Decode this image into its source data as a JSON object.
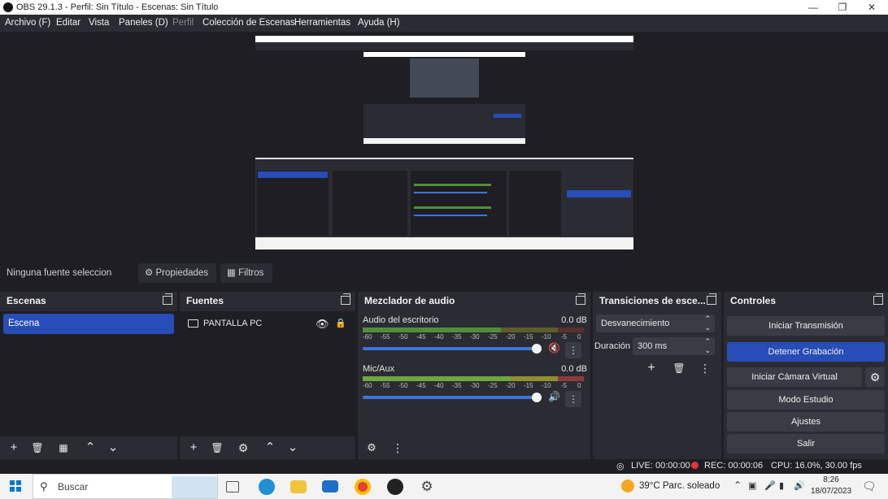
{
  "window": {
    "title": "OBS 29.1.3 - Perfil: Sin Título - Escenas: Sin Título",
    "minimize_icon": "minimize-icon",
    "maximize_icon": "restore-icon",
    "close_icon": "close-icon"
  },
  "menu": {
    "items": [
      "Archivo (F)",
      "Editar",
      "Vista",
      "Paneles (D)",
      "Perfil",
      "Colección de Escenas",
      "Herramientas",
      "Ayuda (H)"
    ]
  },
  "source_toolbar": {
    "no_source": "Ninguna fuente seleccionada",
    "properties": "Propiedades",
    "filters": "Filtros"
  },
  "scenes": {
    "title": "Escenas",
    "items": [
      "Escena"
    ]
  },
  "sources": {
    "title": "Fuentes",
    "items": [
      {
        "name": "PANTALLA PC",
        "icon": "monitor-icon",
        "visible": true,
        "locked": true
      }
    ]
  },
  "mixer": {
    "title": "Mezclador de audio",
    "channels": [
      {
        "name": "Audio del escritorio",
        "db": "0.0 dB",
        "volume": 1.0,
        "muted": true
      },
      {
        "name": "Mic/Aux",
        "db": "0.0 dB",
        "volume": 1.0,
        "muted": false
      }
    ],
    "ticks": [
      "-60",
      "-55",
      "-50",
      "-45",
      "-40",
      "-35",
      "-30",
      "-25",
      "-20",
      "-15",
      "-10",
      "-5",
      "0"
    ]
  },
  "transitions": {
    "title": "Transiciones de esce...",
    "selected": "Desvanecimiento",
    "duration_label": "Duración",
    "duration_value": "300 ms"
  },
  "controls": {
    "title": "Controles",
    "start_stream": "Iniciar Transmisión",
    "stop_recording": "Detener Grabación",
    "start_virtual_cam": "Iniciar Cámara Virtual",
    "studio_mode": "Modo Estudio",
    "settings": "Ajustes",
    "exit": "Salir"
  },
  "status": {
    "live": "LIVE: 00:00:00",
    "rec": "REC: 00:00:06",
    "cpu": "CPU: 16.0%, 30.00 fps"
  },
  "taskbar": {
    "search_placeholder": "Buscar",
    "weather": "39°C  Parc. soleado",
    "time": "8:26",
    "date": "18/07/2023"
  },
  "colors": {
    "accent": "#284cb8",
    "panel": "#2b2c33",
    "background": "#1e1e24"
  }
}
